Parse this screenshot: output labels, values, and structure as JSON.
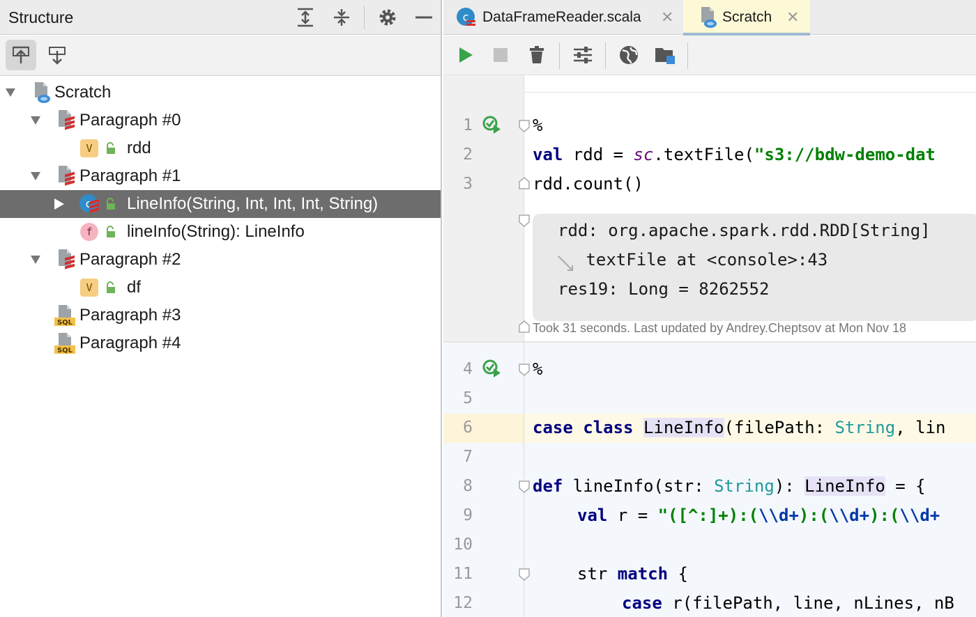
{
  "structure": {
    "title": "Structure",
    "tree": [
      {
        "label": "Scratch",
        "kind": "scratch",
        "expanded": true
      },
      {
        "label": "Paragraph #0",
        "kind": "paragraph",
        "expanded": true
      },
      {
        "label": "rdd",
        "kind": "val",
        "badge": "V"
      },
      {
        "label": "Paragraph #1",
        "kind": "paragraph",
        "expanded": true
      },
      {
        "label": "LineInfo(String, Int, Int, Int, String)",
        "kind": "class",
        "selected": true
      },
      {
        "label": "lineInfo(String): LineInfo",
        "kind": "function",
        "badge": "f"
      },
      {
        "label": "Paragraph #2",
        "kind": "paragraph",
        "expanded": true
      },
      {
        "label": "df",
        "kind": "val",
        "badge": "V"
      },
      {
        "label": "Paragraph #3",
        "kind": "sql"
      },
      {
        "label": "Paragraph #4",
        "kind": "sql"
      }
    ],
    "sql_icon_text": "SQL"
  },
  "editor": {
    "tabs": [
      {
        "label": "DataFrameReader.scala",
        "active": false
      },
      {
        "label": "Scratch",
        "active": true
      }
    ],
    "close_glyph": "✕",
    "toolbar_icons": [
      "run-icon",
      "stop-icon",
      "delete-icon",
      "settings-icon",
      "globe-icon",
      "folder-icon"
    ],
    "line_numbers": [
      "1",
      "2",
      "3",
      "4",
      "5",
      "6",
      "7",
      "8",
      "9",
      "10",
      "11",
      "12"
    ],
    "output": {
      "line1": "rdd: org.apache.spark.rdd.RDD[String]",
      "line2": " textFile at <console>:43",
      "line3": "res19: Long = 8262552"
    },
    "took": "Took 31 seconds. Last updated by Andrey.Cheptsov at Mon Nov 18",
    "code": {
      "l1": "%",
      "l2_kw": "val",
      "l2_a": " rdd = ",
      "l2_sc": "sc",
      "l2_b": ".textFile(",
      "l2_str": "\"s3://bdw-demo-dat",
      "l3": "rdd.count()",
      "l4": "%",
      "l6_kw1": "case",
      "l6_kw2": "class",
      "l6_name": "LineInfo",
      "l6_a": "(filePath: ",
      "l6_type": "String",
      "l6_b": ", lin",
      "l8_kw": "def",
      "l8_a": " lineInfo(str: ",
      "l8_type": "String",
      "l8_b": "): ",
      "l8_ret": "LineInfo",
      "l8_c": " = {",
      "l9_kw": "val",
      "l9_a": " r = ",
      "l9_s1": "\"([^:]+):(",
      "l9_e1": "\\\\d+",
      "l9_s2": "):(",
      "l9_e2": "\\\\d+",
      "l9_s3": "):(",
      "l9_e3": "\\\\d+",
      "l11_a": "str ",
      "l11_kw": "match",
      "l11_b": " {",
      "l12_kw": "case",
      "l12_a": " r(filePath, line, nLines, nB"
    }
  }
}
